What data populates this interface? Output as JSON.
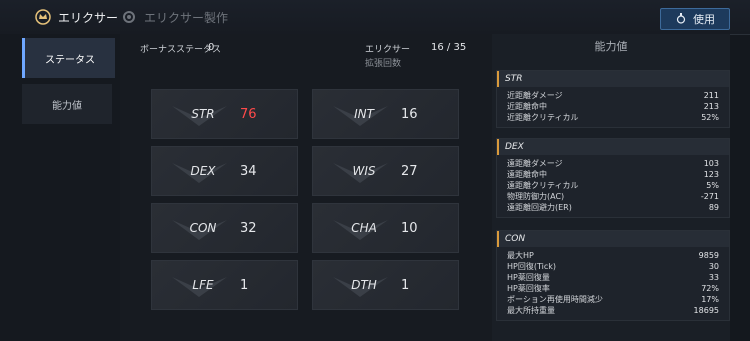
{
  "header": {
    "tab_active": "エリクサー",
    "tab_inactive": "エリクサー製作",
    "use_button": "使用"
  },
  "sidebar": {
    "items": [
      {
        "label": "ステータス"
      },
      {
        "label": "能力値"
      }
    ]
  },
  "summary": {
    "bonus_label": "ボーナスステータス",
    "bonus_value": "0",
    "elixir_label": "エリクサー",
    "elixir_count": "16 / 35",
    "expand_label": "拡張回数"
  },
  "stats": [
    {
      "name": "STR",
      "value": "76"
    },
    {
      "name": "INT",
      "value": "16"
    },
    {
      "name": "DEX",
      "value": "34"
    },
    {
      "name": "WIS",
      "value": "27"
    },
    {
      "name": "CON",
      "value": "32"
    },
    {
      "name": "CHA",
      "value": "10"
    },
    {
      "name": "LFE",
      "value": "1"
    },
    {
      "name": "DTH",
      "value": "1"
    }
  ],
  "abilities": {
    "title": "能力値",
    "sections": [
      {
        "head": "STR",
        "rows": [
          {
            "label": "近距離ダメージ",
            "value": "211"
          },
          {
            "label": "近距離命中",
            "value": "213"
          },
          {
            "label": "近距離クリティカル",
            "value": "52%"
          }
        ]
      },
      {
        "head": "DEX",
        "rows": [
          {
            "label": "遠距離ダメージ",
            "value": "103"
          },
          {
            "label": "遠距離命中",
            "value": "123"
          },
          {
            "label": "遠距離クリティカル",
            "value": "5%"
          },
          {
            "label": "物理防御力(AC)",
            "value": "-271"
          },
          {
            "label": "遠距離回避力(ER)",
            "value": "89"
          }
        ]
      },
      {
        "head": "CON",
        "rows": [
          {
            "label": "最大HP",
            "value": "9859"
          },
          {
            "label": "HP回復(Tick)",
            "value": "30"
          },
          {
            "label": "HP薬回復量",
            "value": "33"
          },
          {
            "label": "HP薬回復率",
            "value": "72%"
          },
          {
            "label": "ポーション再使用時間減少",
            "value": "17%"
          },
          {
            "label": "最大所持重量",
            "value": "18695"
          }
        ]
      }
    ]
  },
  "colors": {
    "highlight_value": "#ff4a4a",
    "accent_blue": "#6fa7ff",
    "section_marker": "#d99a3c"
  }
}
